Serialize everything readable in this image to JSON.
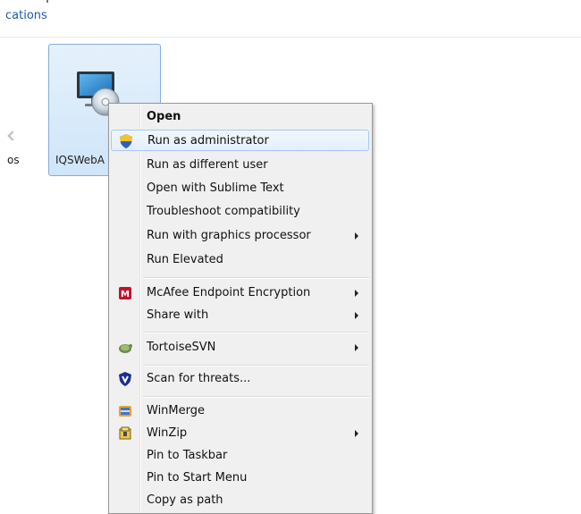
{
  "explorer": {
    "breadcrumb": "cations",
    "left_item_label": "os",
    "selected_file_name": "IQSWebA",
    "selection_color": "#cfe5fa",
    "file_icon": "monitor-disc-icon"
  },
  "context_menu": {
    "items": [
      {
        "label": "Open"
      },
      {
        "label": "Run as administrator",
        "icon": "uac-shield-icon"
      },
      {
        "label": "Run as different user"
      },
      {
        "label": "Open with Sublime Text"
      },
      {
        "label": "Troubleshoot compatibility"
      },
      {
        "label": "Run with graphics processor",
        "submenu": true
      },
      {
        "label": "Run Elevated"
      },
      {
        "label": "McAfee Endpoint Encryption",
        "icon": "mcafee-icon",
        "submenu": true
      },
      {
        "label": "Share with",
        "submenu": true
      },
      {
        "label": "TortoiseSVN",
        "icon": "tortoisesvn-icon",
        "submenu": true
      },
      {
        "label": "Scan for threats...",
        "icon": "mcafee-shield-icon"
      },
      {
        "label": "WinMerge",
        "icon": "winmerge-icon"
      },
      {
        "label": "WinZip",
        "icon": "winzip-icon",
        "submenu": true
      },
      {
        "label": "Pin to Taskbar"
      },
      {
        "label": "Pin to Start Menu"
      },
      {
        "label": "Copy as path"
      }
    ],
    "highlight_color": "#e4eefb"
  }
}
